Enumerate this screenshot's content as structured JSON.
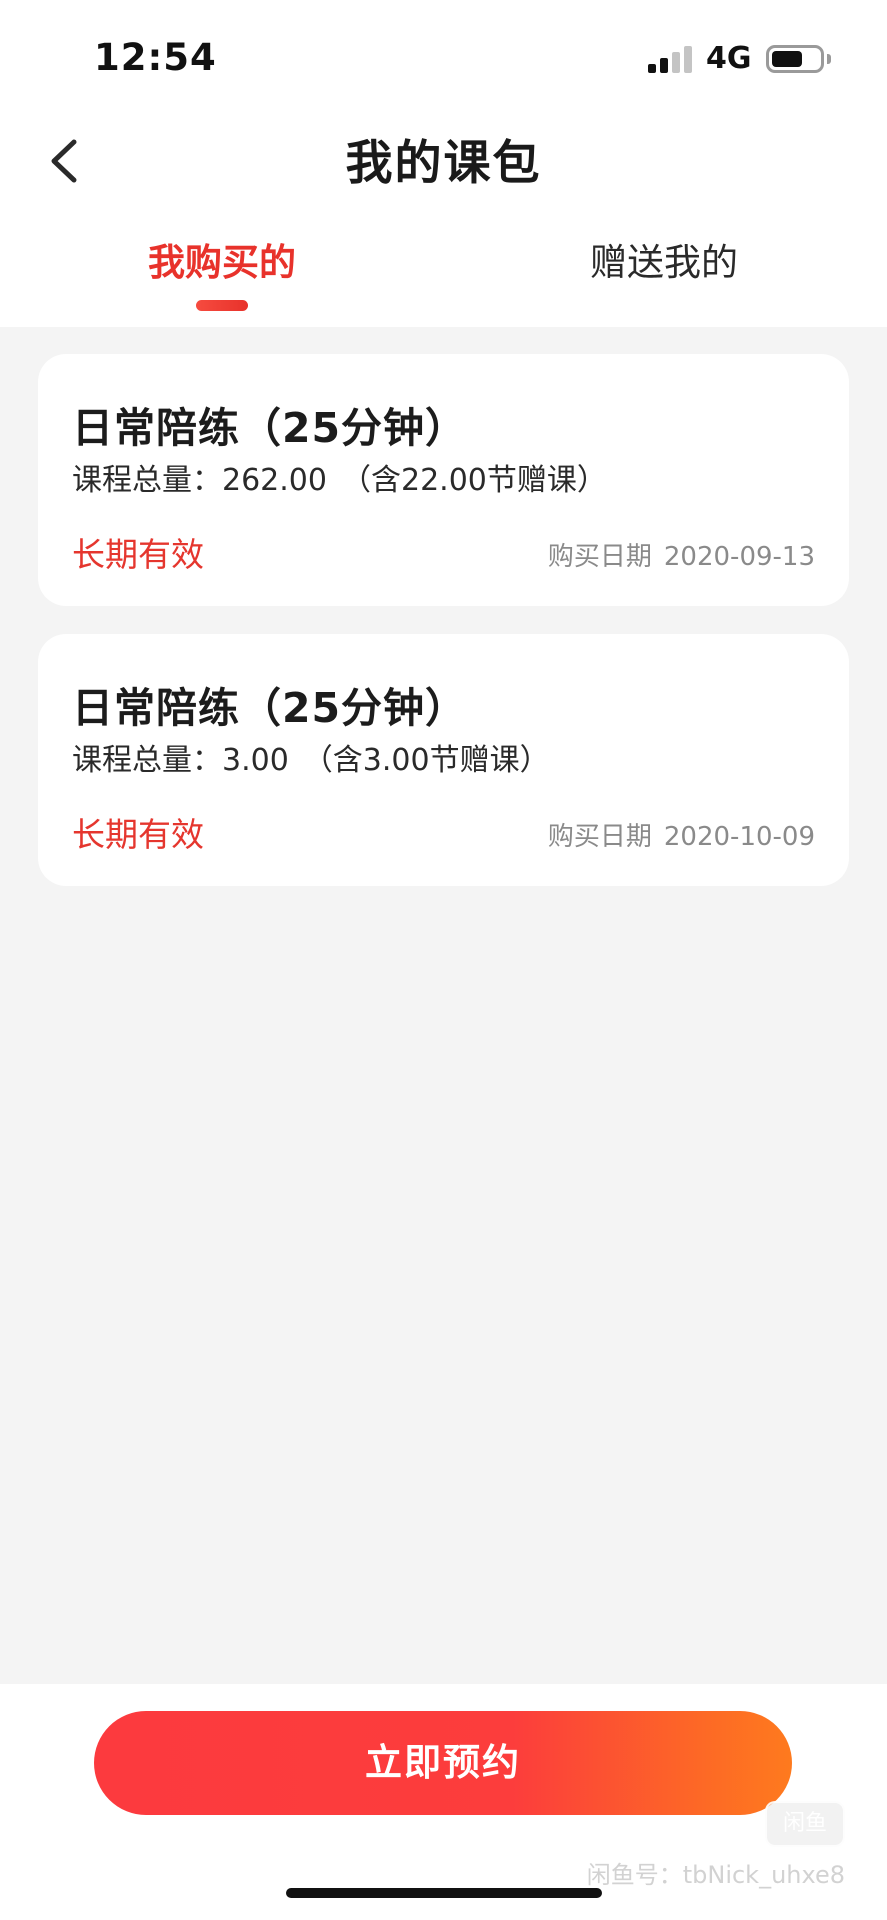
{
  "status_bar": {
    "time": "12:54",
    "network": "4G",
    "signal_bars_active": 2,
    "battery_level": 0.65
  },
  "nav": {
    "title": "我的课包",
    "back_icon": "chevron-left-icon"
  },
  "tabs": [
    {
      "label": "我购买的",
      "active": true
    },
    {
      "label": "赠送我的",
      "active": false
    }
  ],
  "courses": [
    {
      "title": "日常陪练（25分钟）",
      "total_label": "课程总量：",
      "total_value": "262.00",
      "bonus_note": "（含22.00节赠课）",
      "validity": "长期有效",
      "date_label": "购买日期",
      "date_value": "2020-09-13"
    },
    {
      "title": "日常陪练（25分钟）",
      "total_label": "课程总量：",
      "total_value": "3.00",
      "bonus_note": "（含3.00节赠课）",
      "validity": "长期有效",
      "date_label": "购买日期",
      "date_value": "2020-10-09"
    }
  ],
  "actions": {
    "book_label": "立即预约"
  },
  "watermark": {
    "logo_text": "闲鱼",
    "text": "闲鱼号：tbNick_uhxe8"
  },
  "colors": {
    "accent_red": "#e8322b",
    "button_gradient_start": "#fc3a3e",
    "button_gradient_end": "#fe7a1e",
    "background": "#f4f4f4"
  }
}
